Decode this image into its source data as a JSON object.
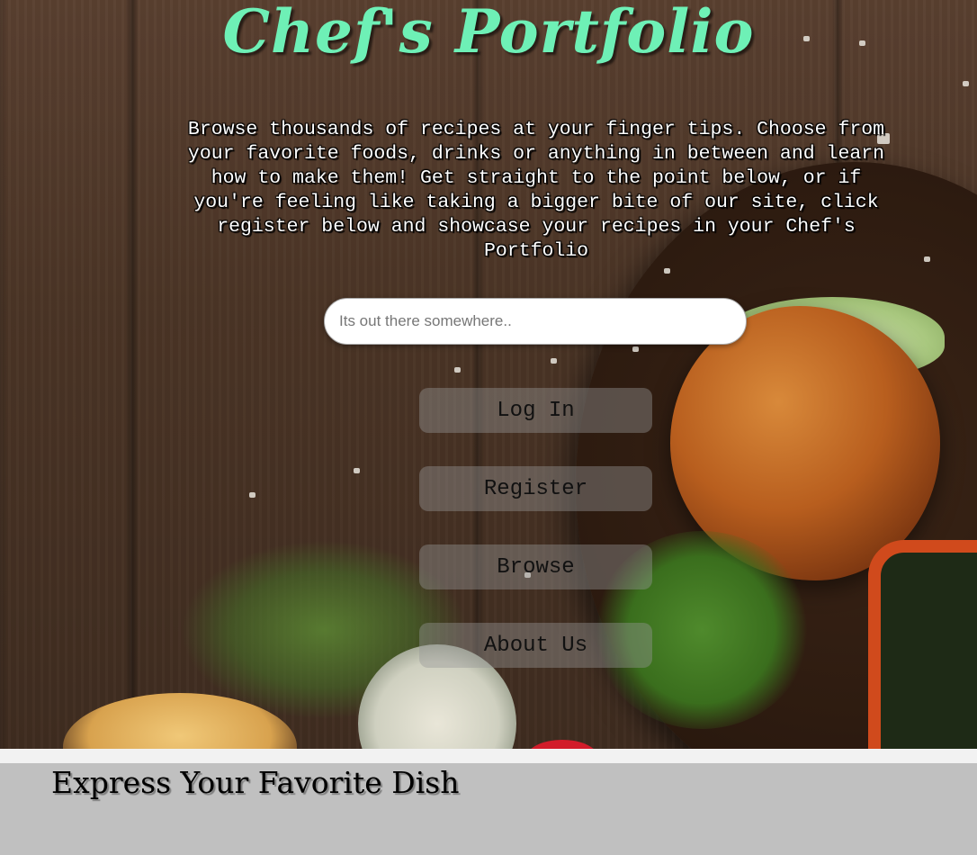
{
  "hero": {
    "title": "Chef's Portfolio",
    "intro": "Browse thousands of recipes at your finger tips. Choose from your favorite foods, drinks or anything in between and learn how to make them! Get straight to the point below, or if you're feeling like taking a bigger bite of our site, click register below and showcase your recipes in your Chef's Portfolio",
    "search": {
      "placeholder": "Its out there somewhere..",
      "value": ""
    },
    "nav": [
      {
        "label": "Log In"
      },
      {
        "label": "Register"
      },
      {
        "label": "Browse"
      },
      {
        "label": "About Us"
      }
    ]
  },
  "footer": {
    "heading": "Express Your Favorite Dish"
  },
  "colors": {
    "title": "#6ef0b6",
    "footer_bg": "#c0c0c0",
    "button_bg": "rgba(150,150,150,0.42)"
  }
}
